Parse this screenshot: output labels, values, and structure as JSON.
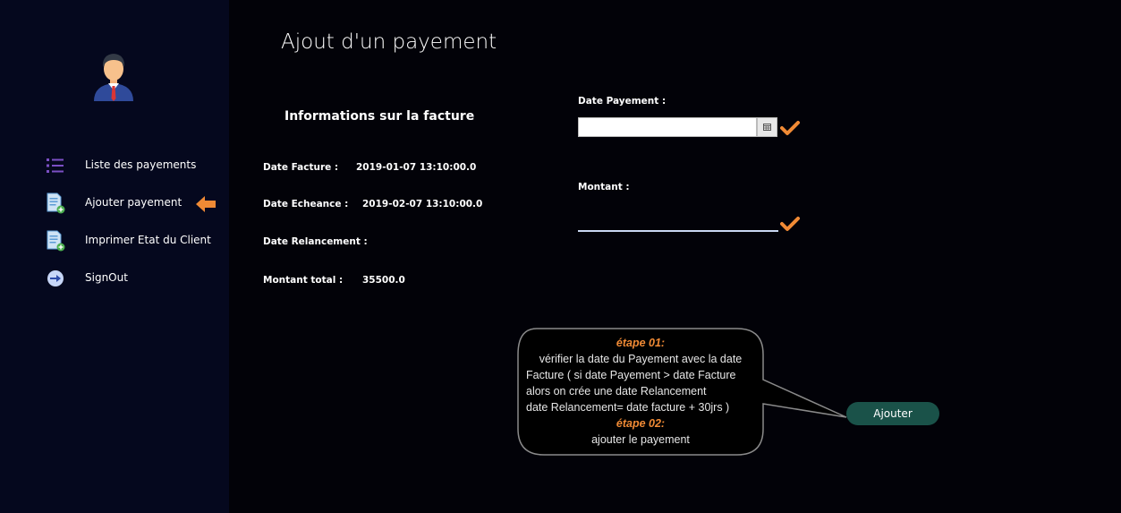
{
  "sidebar": {
    "items": [
      {
        "label": "Liste des payements",
        "icon": "list-icon"
      },
      {
        "label": "Ajouter payement",
        "icon": "document-add-icon"
      },
      {
        "label": "Imprimer Etat du Client",
        "icon": "document-print-icon"
      },
      {
        "label": "SignOut",
        "icon": "signout-icon"
      }
    ],
    "active_indicator_icon": "arrow-left-icon",
    "accent_color": "#f08a35"
  },
  "page": {
    "title": "Ajout d'un payement"
  },
  "invoice": {
    "section_title": "Informations sur la facture",
    "date_facture_label": "Date Facture :",
    "date_facture_value": "2019-01-07 13:10:00.0",
    "date_echeance_label": "Date Echeance :",
    "date_echeance_value": "2019-02-07 13:10:00.0",
    "date_relancement_label": "Date Relancement :",
    "date_relancement_value": "",
    "montant_total_label": "Montant total :",
    "montant_total_value": "35500.0"
  },
  "form": {
    "date_payement_label": "Date Payement :",
    "date_payement_value": "",
    "montant_label": "Montant :",
    "montant_value": ""
  },
  "tooltip": {
    "step1_title": "étape 01:",
    "step1_line1": "vérifier la date du Payement avec la date",
    "step1_line2": "Facture ( si date Payement > date Facture",
    "step1_line3": "alors on crée une date Relancement",
    "step1_line4": "date Relancement= date facture + 30jrs )",
    "step2_title": "étape 02:",
    "step2_line1": "ajouter le payement"
  },
  "actions": {
    "add_label": "Ajouter"
  },
  "colors": {
    "sidebar_bg": "#05081e",
    "main_bg": "#020208",
    "button_bg": "#1a5249",
    "check_color": "#f08a35"
  }
}
